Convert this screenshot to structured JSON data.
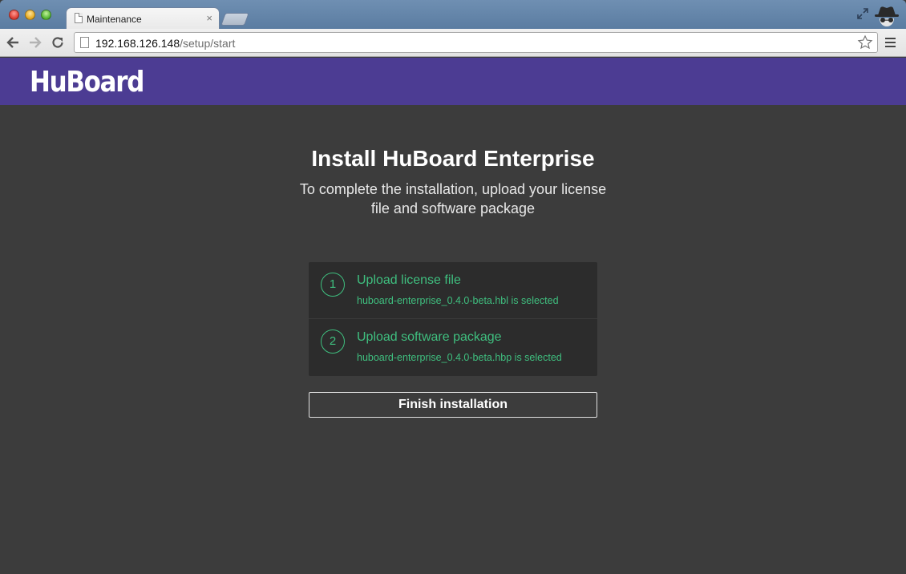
{
  "browser": {
    "tab": {
      "title": "Maintenance",
      "close_glyph": "×"
    },
    "address": {
      "host": "192.168.126.148",
      "path": "/setup/start"
    },
    "icons": [
      "back-icon",
      "forward-icon",
      "reload-icon",
      "page-icon",
      "star-icon",
      "menu-icon",
      "fullscreen-icon",
      "incognito-icon"
    ]
  },
  "header": {
    "logo": "HuBoard",
    "brand_color": "#4c3c93"
  },
  "main": {
    "title": "Install HuBoard Enterprise",
    "subtitle": "To complete the installation, upload your license file and software package",
    "steps": [
      {
        "number": "1",
        "label": "Upload license file",
        "status": "huboard-enterprise_0.4.0-beta.hbl is selected"
      },
      {
        "number": "2",
        "label": "Upload software package",
        "status": "huboard-enterprise_0.4.0-beta.hbp is selected"
      }
    ],
    "finish_label": "Finish installation",
    "accent_color": "#3fbf7f"
  }
}
